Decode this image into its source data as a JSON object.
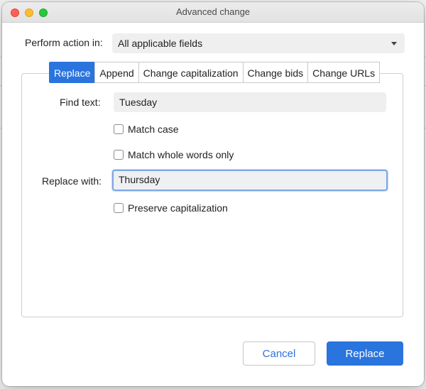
{
  "window": {
    "title": "Advanced change"
  },
  "perform": {
    "label": "Perform action in:",
    "selected": "All applicable fields"
  },
  "tabs": [
    {
      "label": "Replace",
      "active": true
    },
    {
      "label": "Append",
      "active": false
    },
    {
      "label": "Change capitalization",
      "active": false
    },
    {
      "label": "Change bids",
      "active": false
    },
    {
      "label": "Change URLs",
      "active": false
    }
  ],
  "find": {
    "label": "Find text:",
    "value": "Tuesday"
  },
  "options": {
    "match_case": "Match case",
    "match_whole_words": "Match whole words only",
    "preserve_capitalization": "Preserve capitalization"
  },
  "replace": {
    "label": "Replace with:",
    "value": "Thursday"
  },
  "buttons": {
    "cancel": "Cancel",
    "replace": "Replace"
  },
  "colors": {
    "accent": "#2a74de"
  }
}
